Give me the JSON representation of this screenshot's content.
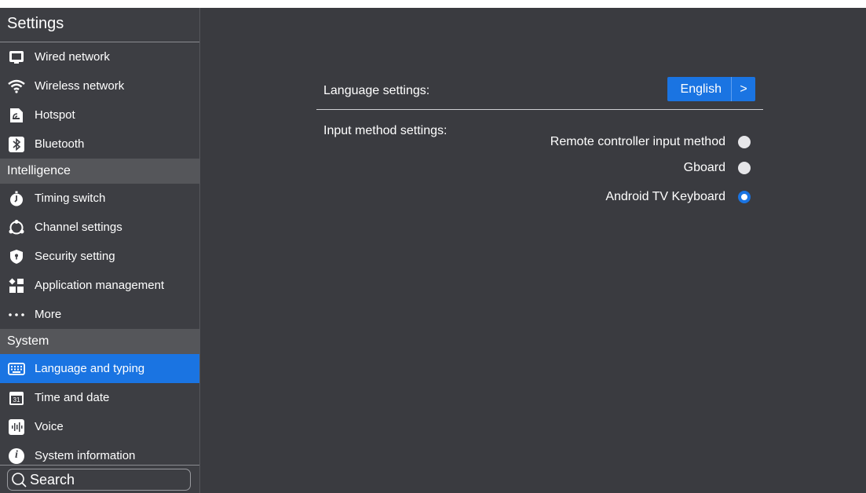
{
  "sidebar": {
    "title": "Settings",
    "group1": [
      {
        "label": "Wired network",
        "icon": "monitor-icon"
      },
      {
        "label": "Wireless network",
        "icon": "wifi-icon"
      },
      {
        "label": "Hotspot",
        "icon": "hotspot-icon"
      },
      {
        "label": "Bluetooth",
        "icon": "bluetooth-icon"
      }
    ],
    "section_intelligence": "Intelligence",
    "group2": [
      {
        "label": "Timing switch",
        "icon": "timer-icon"
      },
      {
        "label": "Channel settings",
        "icon": "channel-icon"
      },
      {
        "label": "Security setting",
        "icon": "shield-icon"
      },
      {
        "label": "Application management",
        "icon": "apps-icon"
      },
      {
        "label": "More",
        "icon": "more-dots-icon"
      }
    ],
    "section_system": "System",
    "group3": [
      {
        "label": "Language and typing",
        "icon": "keyboard-icon",
        "active": true
      },
      {
        "label": "Time and date",
        "icon": "calendar-icon",
        "badge": "31"
      },
      {
        "label": "Voice",
        "icon": "voice-icon"
      },
      {
        "label": "System information",
        "icon": "info-icon",
        "glyph": "i"
      }
    ],
    "search_label": "Search"
  },
  "main": {
    "language_label": "Language settings:",
    "language_value": "English",
    "language_arrow": ">",
    "input_method_label": "Input method settings:",
    "input_methods": [
      {
        "label": "Remote controller input method",
        "selected": false
      },
      {
        "label": "Gboard",
        "selected": false
      },
      {
        "label": "Android TV Keyboard",
        "selected": true
      }
    ]
  },
  "colors": {
    "accent": "#1a74e2",
    "background": "#3a3b40",
    "sidebar": "#3d3e43",
    "section": "#55565a"
  }
}
